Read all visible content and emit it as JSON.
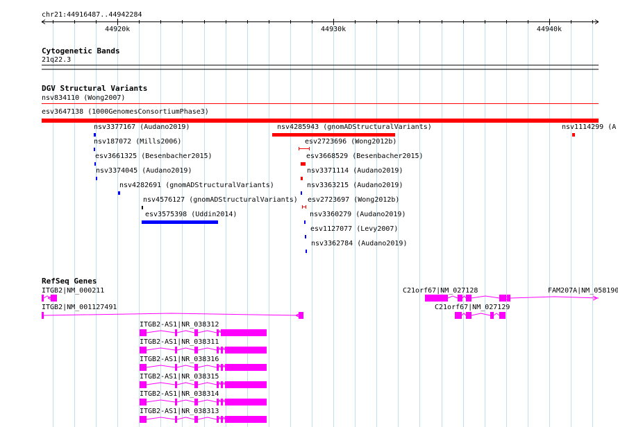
{
  "region": "chr21:44916487..44942284",
  "ruler": {
    "ticks": [
      {
        "pos": 44920000,
        "label": "44920k"
      },
      {
        "pos": 44930000,
        "label": "44930k"
      },
      {
        "pos": 44940000,
        "label": "44940k"
      }
    ]
  },
  "tracks": {
    "cytobands": {
      "title": "Cytogenetic Bands",
      "band": "21q22.3"
    },
    "dgv": {
      "title": "DGV Structural Variants",
      "features": [
        {
          "label": "nsv834110 (Wong2007)",
          "start": 44916487,
          "end": 44942284,
          "color": "#ff0000",
          "kind": "line"
        },
        {
          "label": "esv3647138 (1000GenomesConsortiumPhase3)",
          "start": 44916487,
          "end": 44942284,
          "color": "#ff0000",
          "kind": "bar"
        },
        {
          "label": "nsv3377167 (Audano2019)",
          "start": 44918900,
          "end": 44918980,
          "color": "#0000ff",
          "kind": "bar"
        },
        {
          "label": "nsv187072 (Mills2006)",
          "start": 44918900,
          "end": 44918960,
          "color": "#0000ff",
          "kind": "bar"
        },
        {
          "label": "esv3661325 (Besenbacher2015)",
          "start": 44918920,
          "end": 44918980,
          "color": "#0000ff",
          "kind": "bar"
        },
        {
          "label": "nsv3374045 (Audano2019)",
          "start": 44918990,
          "end": 44919050,
          "color": "#0000ff",
          "kind": "bar"
        },
        {
          "label": "nsv4282691 (gnomADStructuralVariants)",
          "start": 44920010,
          "end": 44920110,
          "color": "#0000ff",
          "kind": "bar"
        },
        {
          "label": "nsv4576127 (gnomADStructuralVariants)",
          "start": 44921110,
          "end": 44921170,
          "color": "#000000",
          "kind": "bar"
        },
        {
          "label": "esv3575398 (Uddin2014)",
          "start": 44921110,
          "end": 44924650,
          "color": "#0000ff",
          "kind": "bar"
        },
        {
          "label": "nsv4285943 (gnomADStructuralVariants)",
          "start": 44927150,
          "end": 44932850,
          "color": "#ff0000",
          "kind": "bar"
        },
        {
          "label": "nsv1114299 (A",
          "start": 44941070,
          "end": 44941200,
          "color": "#ff0000",
          "kind": "bar"
        },
        {
          "label": "esv2723696 (Wong2012b)",
          "start": 44928400,
          "end": 44928900,
          "color": "#ff0000",
          "kind": "interval"
        },
        {
          "label": "esv3668529 (Besenbacher2015)",
          "start": 44928500,
          "end": 44928700,
          "color": "#ff0000",
          "kind": "bar"
        },
        {
          "label": "nsv3371114 (Audano2019)",
          "start": 44928500,
          "end": 44928580,
          "color": "#ff0000",
          "kind": "bar"
        },
        {
          "label": "nsv3363215 (Audano2019)",
          "start": 44928500,
          "end": 44928560,
          "color": "#0000ff",
          "kind": "bar"
        },
        {
          "label": "esv2723697 (Wong2012b)",
          "start": 44928560,
          "end": 44928740,
          "color": "#ff0000",
          "kind": "interval"
        },
        {
          "label": "nsv3360279 (Audano2019)",
          "start": 44928640,
          "end": 44928700,
          "color": "#0000ff",
          "kind": "bar"
        },
        {
          "label": "esv1127077 (Levy2007)",
          "start": 44928690,
          "end": 44928750,
          "color": "#0000ff",
          "kind": "bar"
        },
        {
          "label": "nsv3362784 (Audano2019)",
          "start": 44928720,
          "end": 44928780,
          "color": "#0000ff",
          "kind": "bar"
        }
      ]
    },
    "refseq": {
      "title": "RefSeq Genes",
      "color": "#ff00ff",
      "genes": [
        {
          "label": "ITGB2|NM_000211",
          "start": 44916487,
          "end": 44917180,
          "strand": "-",
          "exons": [
            [
              44916487,
              44916560
            ],
            [
              44916900,
              44917180
            ]
          ]
        },
        {
          "label": "ITGB2|NM_001127491",
          "start": 44916487,
          "end": 44928600,
          "strand": "-",
          "exons": [
            [
              44916487,
              44916530
            ],
            [
              44928380,
              44928600
            ]
          ]
        },
        {
          "label": "C21orf67|NM_027128",
          "start": 44934240,
          "end": 44938200,
          "strand": "+",
          "exons": [
            [
              44934240,
              44935320
            ],
            [
              44935770,
              44935980
            ],
            [
              44936130,
              44936400
            ],
            [
              44937670,
              44937980
            ],
            [
              44938030,
              44938200
            ]
          ]
        },
        {
          "label": "FAM207A|NM_058190",
          "start": 44937900,
          "end": 44942284,
          "strand": "+",
          "exons": [
            [
              44937900,
              44937980
            ],
            [
              44938030,
              44938200
            ]
          ]
        },
        {
          "label": "C21orf67|NM_027129",
          "start": 44935610,
          "end": 44937980,
          "strand": "+",
          "exons": [
            [
              44935610,
              44935960
            ],
            [
              44936130,
              44936400
            ],
            [
              44937280,
              44937430
            ],
            [
              44937670,
              44937980
            ]
          ]
        },
        {
          "label": "ITGB2-AS1|NR_038312",
          "start": 44921010,
          "end": 44925290,
          "strand": "+",
          "exons": [
            [
              44921010,
              44921330
            ],
            [
              44922650,
              44922750
            ],
            [
              44923560,
              44923720
            ],
            [
              44924590,
              44924680
            ],
            [
              44924800,
              44925290
            ],
            [
              44925290,
              44926900
            ]
          ]
        },
        {
          "label": "ITGB2-AS1|NR_038311",
          "start": 44921010,
          "end": 44926900,
          "strand": "+",
          "exons": [
            [
              44921010,
              44921330
            ],
            [
              44922650,
              44922750
            ],
            [
              44923560,
              44923720
            ],
            [
              44924590,
              44924680
            ],
            [
              44924800,
              44924880
            ],
            [
              44924980,
              44926900
            ]
          ]
        },
        {
          "label": "ITGB2-AS1|NR_038316",
          "start": 44921010,
          "end": 44926900,
          "strand": "+",
          "exons": [
            [
              44921010,
              44921330
            ],
            [
              44922650,
              44922750
            ],
            [
              44923560,
              44923720
            ],
            [
              44924590,
              44924680
            ],
            [
              44924800,
              44924880
            ],
            [
              44924980,
              44926900
            ]
          ]
        },
        {
          "label": "ITGB2-AS1|NR_038315",
          "start": 44921010,
          "end": 44926900,
          "strand": "+",
          "exons": [
            [
              44921010,
              44921330
            ],
            [
              44922650,
              44922750
            ],
            [
              44923560,
              44923720
            ],
            [
              44924590,
              44924680
            ],
            [
              44924800,
              44924880
            ],
            [
              44924980,
              44926900
            ]
          ]
        },
        {
          "label": "ITGB2-AS1|NR_038314",
          "start": 44921010,
          "end": 44926900,
          "strand": "+",
          "exons": [
            [
              44921010,
              44921330
            ],
            [
              44922650,
              44922750
            ],
            [
              44923560,
              44923720
            ],
            [
              44924590,
              44924680
            ],
            [
              44924800,
              44924880
            ],
            [
              44924980,
              44926900
            ]
          ]
        },
        {
          "label": "ITGB2-AS1|NR_038313",
          "start": 44921010,
          "end": 44926900,
          "strand": "+",
          "exons": [
            [
              44921010,
              44921330
            ],
            [
              44922650,
              44922750
            ],
            [
              44923560,
              44923720
            ],
            [
              44924590,
              44924680
            ],
            [
              44924800,
              44924880
            ],
            [
              44924980,
              44926900
            ]
          ]
        }
      ]
    }
  }
}
